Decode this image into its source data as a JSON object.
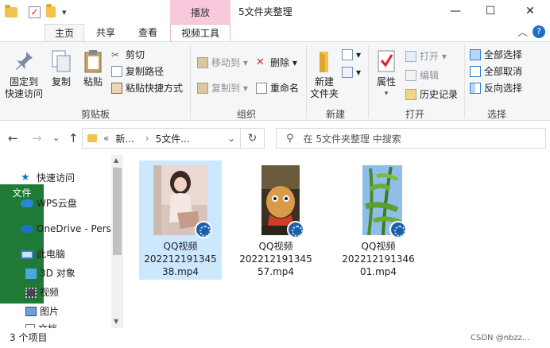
{
  "window": {
    "title": "5文件夹整理",
    "context_tab": "播放",
    "minimize": "—",
    "maximize": "☐",
    "close": "✕",
    "qa_dropdown": "▾"
  },
  "tabs": {
    "file": "文件",
    "home": "主页",
    "share": "共享",
    "view": "查看",
    "video_tools": "视频工具",
    "collapse": "︿",
    "help": "?"
  },
  "ribbon": {
    "clipboard": {
      "pin": "固定到\n快速访问",
      "copy": "复制",
      "paste": "粘贴",
      "cut": "剪切",
      "copy_path": "复制路径",
      "paste_shortcut": "粘贴快捷方式",
      "label": "剪贴板"
    },
    "organize": {
      "move_to": "移动到",
      "copy_to": "复制到",
      "delete": "删除",
      "rename": "重命名",
      "label": "组织"
    },
    "new": {
      "new_folder": "新建\n文件夹",
      "label": "新建"
    },
    "open": {
      "properties": "属性",
      "open": "打开",
      "edit": "编辑",
      "history": "历史记录",
      "label": "打开"
    },
    "select": {
      "select_all": "全部选择",
      "select_none": "全部取消",
      "invert": "反向选择",
      "label": "选择"
    }
  },
  "address": {
    "crumb_overflow": "«",
    "crumb1": "新...",
    "crumb_sep": "›",
    "crumb2": "5文件...",
    "dropdown": "⌄",
    "search_placeholder": "在 5文件夹整理 中搜索"
  },
  "nav": {
    "back": "←",
    "forward": "→",
    "history": "⌄",
    "up": "↑",
    "refresh": "↻",
    "items": [
      {
        "label": "快速访问"
      },
      {
        "label": "WPS云盘"
      },
      {
        "label": "OneDrive - Perso"
      },
      {
        "label": "此电脑"
      },
      {
        "label": "3D 对象"
      },
      {
        "label": "视频"
      },
      {
        "label": "图片"
      },
      {
        "label": "文档"
      }
    ],
    "scroll_up": "▲",
    "scroll_down": "▼"
  },
  "files": [
    {
      "name_line1": "QQ视频",
      "name_line2": "202212191345",
      "name_line3": "38.mp4"
    },
    {
      "name_line1": "QQ视频",
      "name_line2": "202212191345",
      "name_line3": "57.mp4"
    },
    {
      "name_line1": "QQ视频",
      "name_line2": "202212191346",
      "name_line3": "01.mp4"
    }
  ],
  "status": {
    "count": "3 个项目",
    "watermark": "CSDN @nbzz..."
  },
  "colors": {
    "file_tab": "#1e7a35",
    "context_tab": "#f8c8dc",
    "selection": "#cce8ff",
    "accent": "#1f6fc5"
  }
}
